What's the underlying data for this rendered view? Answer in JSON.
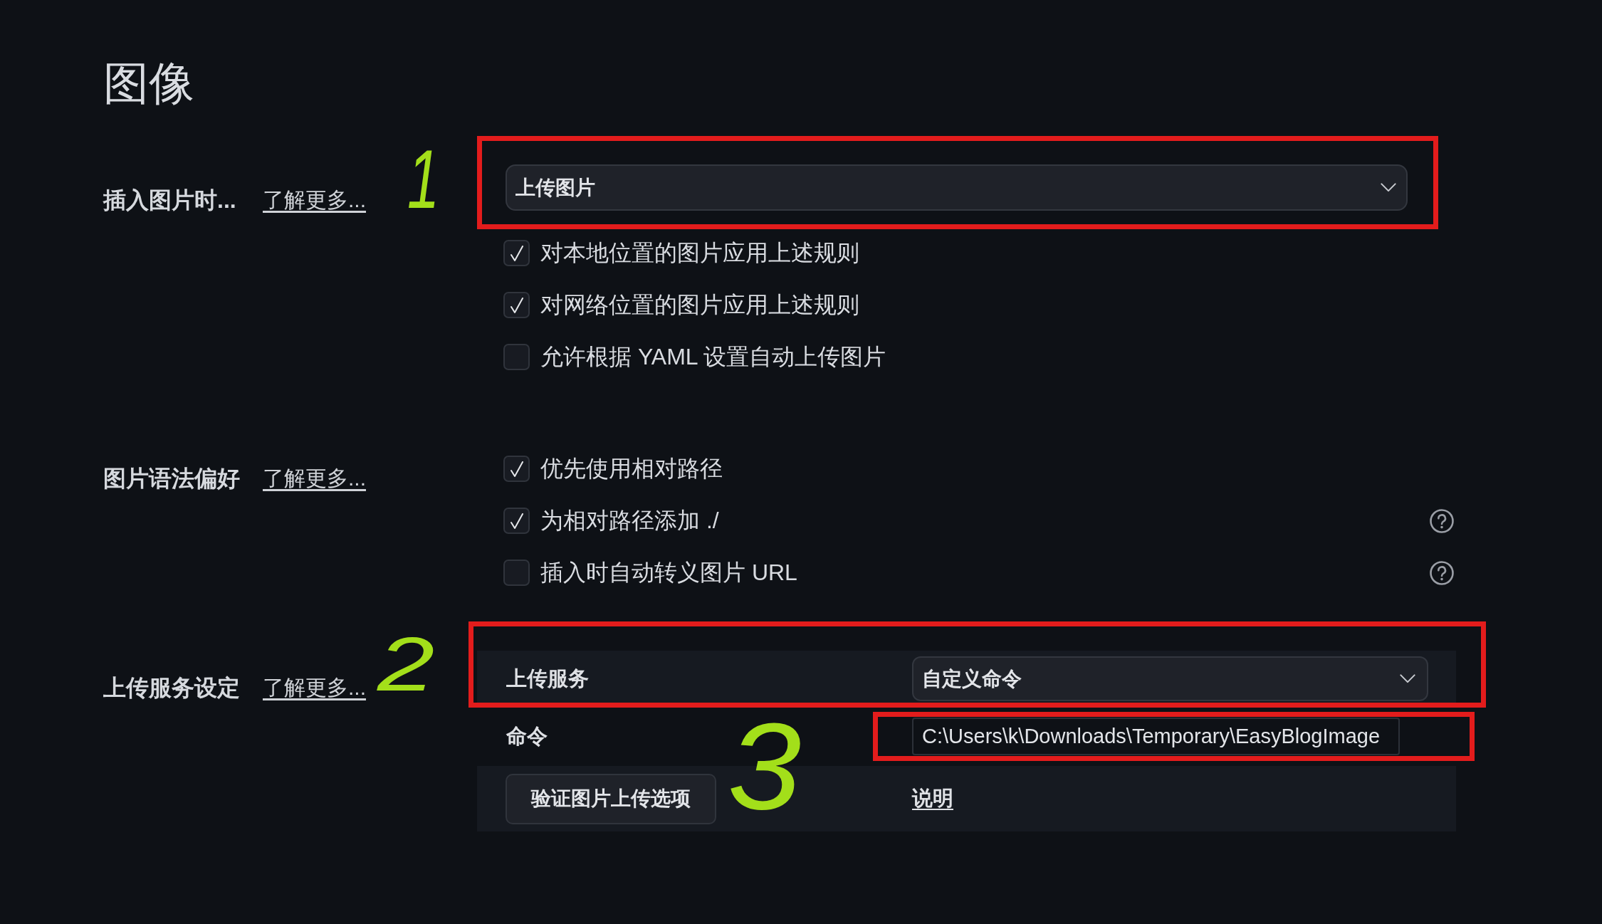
{
  "page": {
    "title": "图像"
  },
  "sections": [
    {
      "kind": "select",
      "label": "插入图片时...",
      "link": "了解更多...",
      "dropdown": {
        "value": "上传图片",
        "highlighted": true
      },
      "options": [
        {
          "label": "对本地位置的图片应用上述规则",
          "checked": true,
          "help": false
        },
        {
          "label": "对网络位置的图片应用上述规则",
          "checked": true,
          "help": false
        },
        {
          "label": "允许根据 YAML 设置自动上传图片",
          "checked": false,
          "help": false
        }
      ]
    },
    {
      "kind": "checklist",
      "label": "图片语法偏好",
      "link": "了解更多...",
      "options": [
        {
          "label": "优先使用相对路径",
          "checked": true,
          "help": false
        },
        {
          "label": "为相对路径添加 ./",
          "checked": true,
          "help": true
        },
        {
          "label": "插入时自动转义图片 URL",
          "checked": false,
          "help": true
        }
      ]
    },
    {
      "kind": "upload",
      "label": "上传服务设定",
      "link": "了解更多...",
      "upload": {
        "service": {
          "label": "上传服务",
          "value": "自定义命令",
          "highlighted": true
        },
        "command": {
          "label": "命令",
          "value": "C:\\Users\\k\\Downloads\\Temporary\\EasyBlogImage",
          "highlighted": true
        },
        "validate_button": "验证图片上传选项",
        "help_link": "说明"
      }
    }
  ],
  "annotations": [
    {
      "label": "1"
    },
    {
      "label": "2"
    },
    {
      "label": "3"
    }
  ]
}
